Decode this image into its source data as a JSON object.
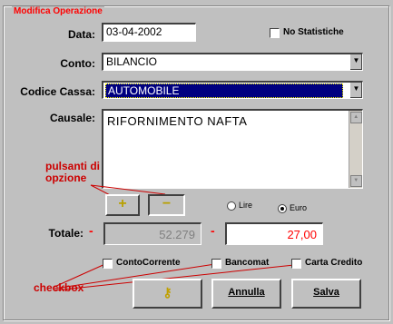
{
  "group_title": "Modifica Operazione",
  "data": {
    "label": "Data:",
    "value": "03-04-2002"
  },
  "no_statistiche": {
    "label": "No Statistiche",
    "checked": false
  },
  "conto": {
    "label": "Conto:",
    "value": "BILANCIO"
  },
  "codice_cassa": {
    "label": "Codice Cassa:",
    "value": "AUTOMOBILE"
  },
  "causale": {
    "label": "Causale:",
    "value": "RIFORNIMENTO NAFTA"
  },
  "annotations": {
    "option_buttons": "pulsanti di opzione",
    "checkboxes": "checkbox"
  },
  "sign_buttons": {
    "plus": "+",
    "minus": "−"
  },
  "currency": {
    "lire": "Lire",
    "euro": "Euro",
    "selected": "Euro"
  },
  "totale": {
    "label": "Totale:",
    "sign_left": "-",
    "value_left": "52.279",
    "sign_right": "-",
    "value_right": "27,00"
  },
  "checks": [
    {
      "label": "ContoCorrente",
      "checked": false
    },
    {
      "label": "Bancomat",
      "checked": false
    },
    {
      "label": "Carta Credito",
      "checked": false
    }
  ],
  "buttons": {
    "help_icon": "key-icon",
    "annulla": "Annulla",
    "salva": "Salva"
  },
  "colors": {
    "accent_red": "#ff0000",
    "selection_blue": "#000080",
    "key_yellow": "#e0c000"
  }
}
